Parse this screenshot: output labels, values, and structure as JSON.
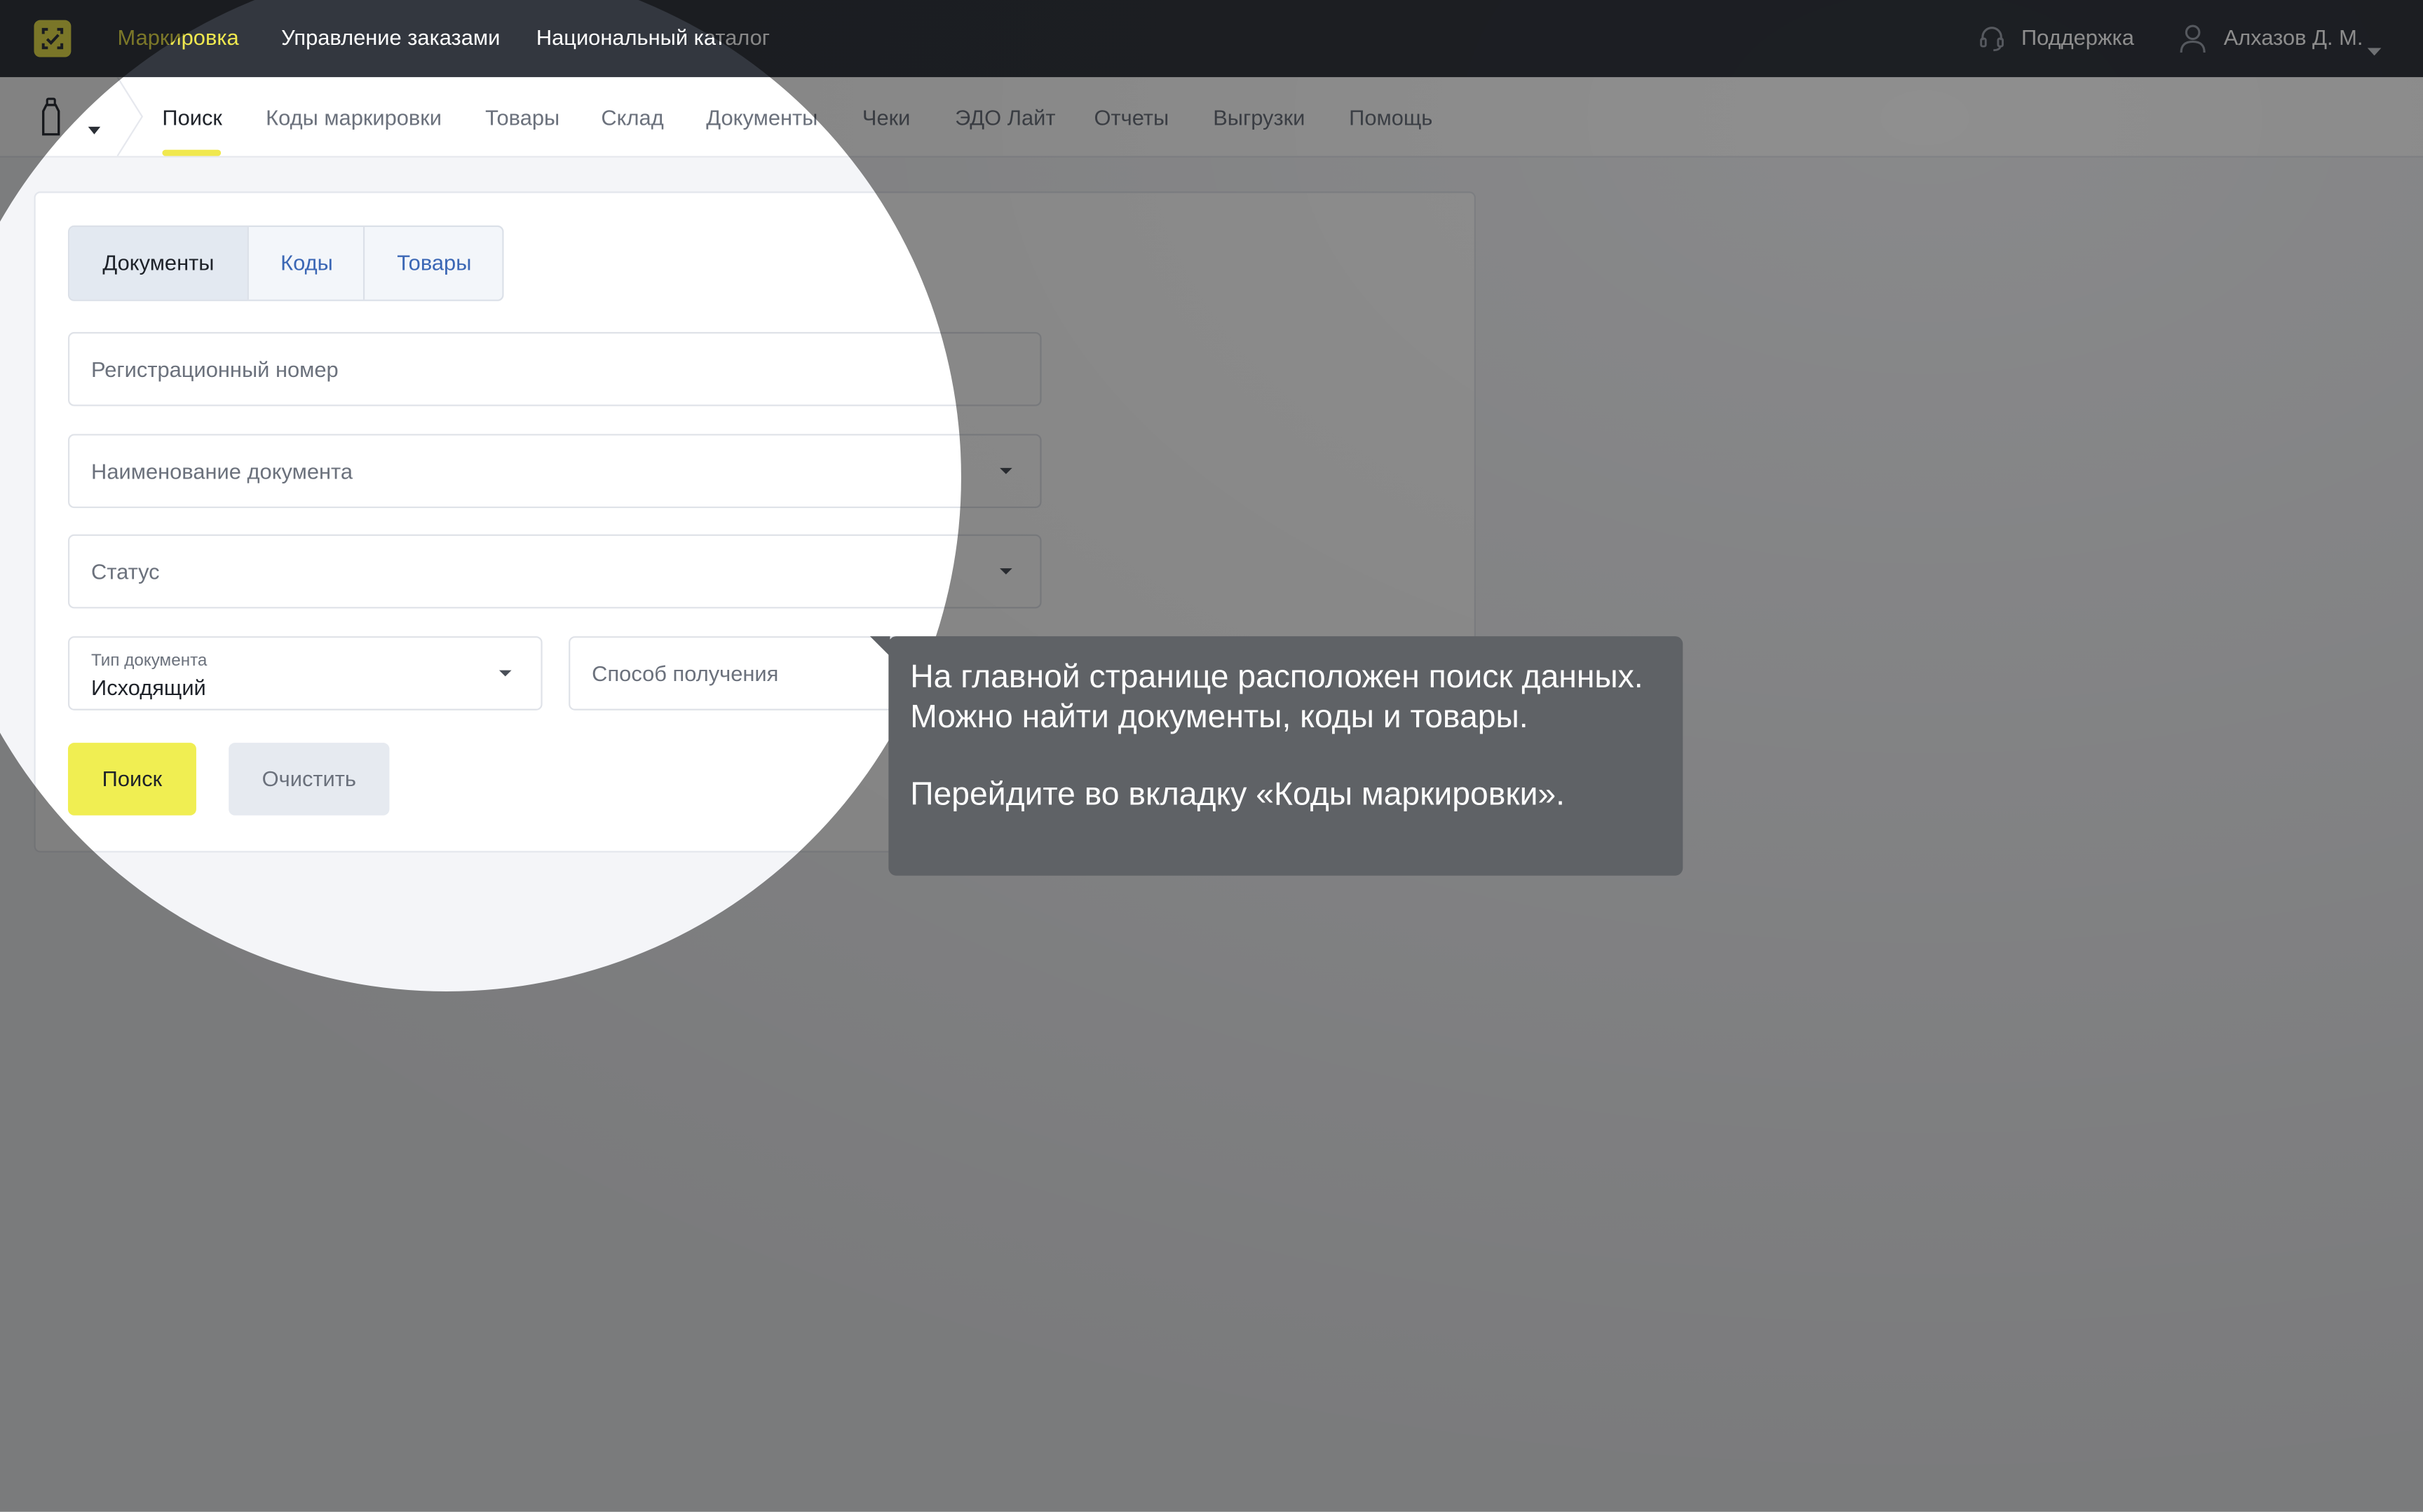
{
  "topbar": {
    "nav": [
      "Маркировка",
      "Управление заказами",
      "Национальный каталог"
    ],
    "support": "Поддержка",
    "user": "Алхазов Д. М.",
    "accent_color": "#f0e84f",
    "background_color": "#33373f"
  },
  "subnav": {
    "product_icon": "bottle-icon",
    "tabs": [
      "Поиск",
      "Коды маркировки",
      "Товары",
      "Склад",
      "Документы",
      "Чеки",
      "ЭДО Лайт",
      "Отчеты",
      "Выгрузки",
      "Помощь"
    ],
    "active_tab": "Поиск"
  },
  "search": {
    "segments": [
      "Документы",
      "Коды",
      "Товары"
    ],
    "active_segment": "Документы",
    "registration_number_placeholder": "Регистрационный номер",
    "document_name_placeholder": "Наименование документа",
    "status_placeholder": "Статус",
    "doc_type_label": "Тип документа",
    "doc_type_value": "Исходящий",
    "receive_method_placeholder": "Способ получения",
    "search_button": "Поиск",
    "clear_button": "Очистить"
  },
  "tooltip": {
    "text1": "На главной странице расположен поиск данных. Можно найти документы, коды и товары.",
    "text2": "Перейдите во вкладку «Коды маркировки».",
    "background_color": "#5f6266"
  }
}
